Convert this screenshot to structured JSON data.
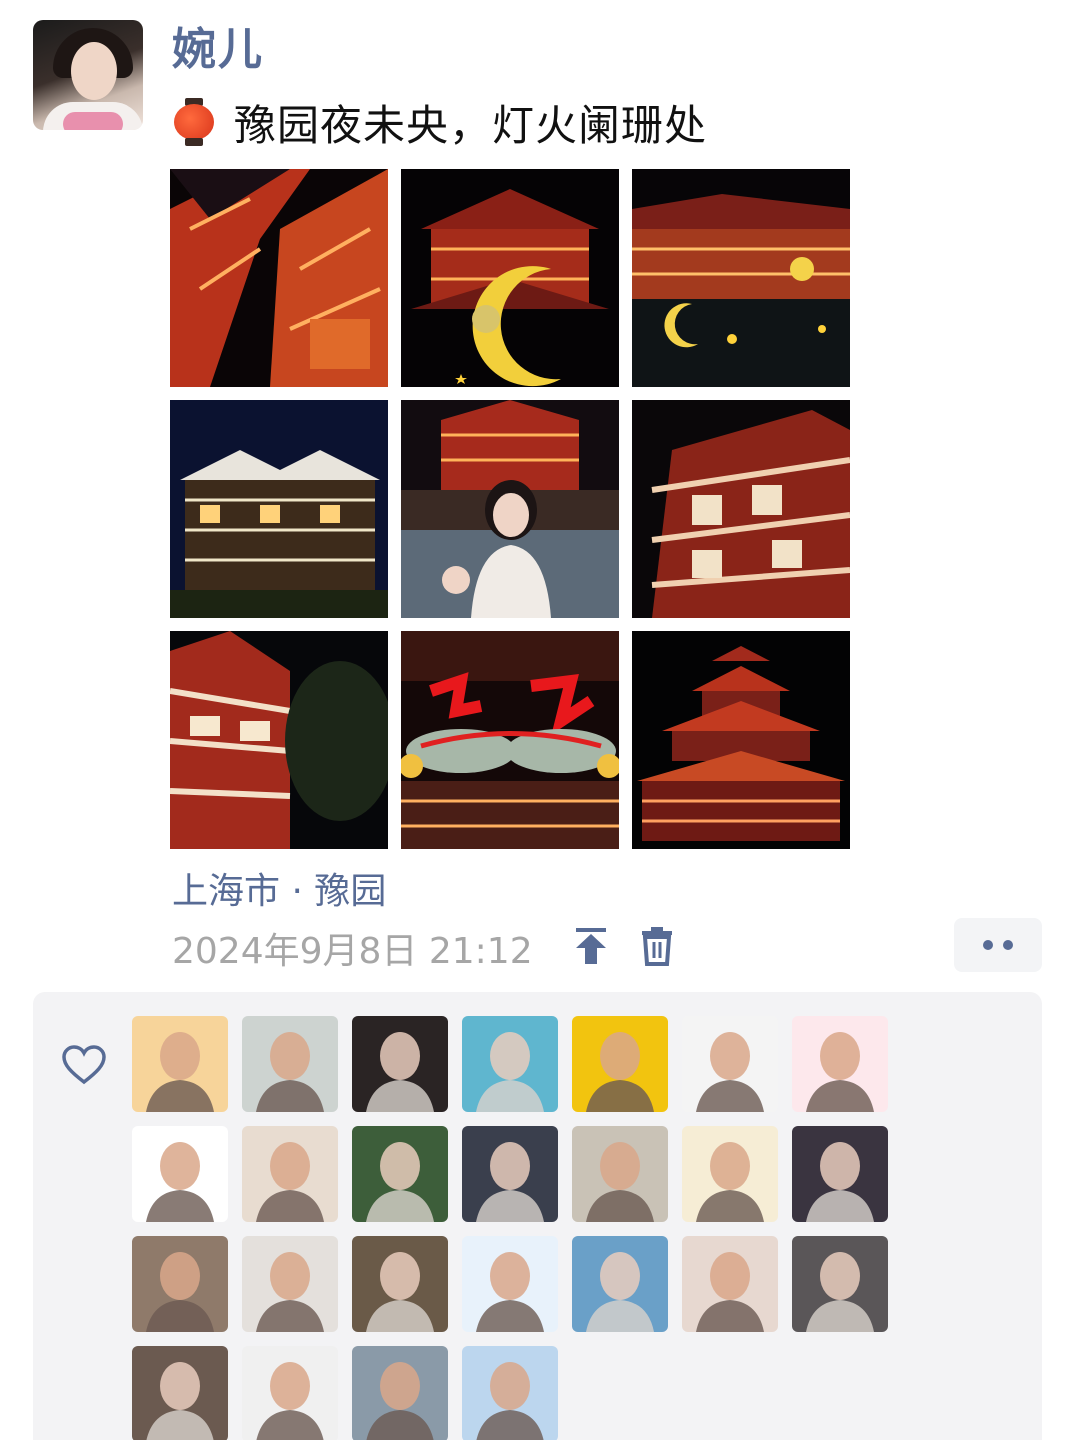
{
  "post": {
    "author": "婉儿",
    "caption": "豫园夜未央，灯火阑珊处",
    "caption_emoji": "lantern-icon",
    "location": "上海市 · 豫园",
    "timestamp": "2024年9月8日 21:12"
  },
  "photos": [
    {
      "name": "photo-1",
      "subject": "red-lit eaves close-up"
    },
    {
      "name": "photo-2",
      "subject": "pavilion with crescent moon lantern"
    },
    {
      "name": "photo-3",
      "subject": "pavilion over water with moon decorations"
    },
    {
      "name": "photo-4",
      "subject": "white-lit pavilion"
    },
    {
      "name": "photo-5",
      "subject": "selfie in street with pagoda"
    },
    {
      "name": "photo-6",
      "subject": "red-lit building corner"
    },
    {
      "name": "photo-7",
      "subject": "lit tower with tree"
    },
    {
      "name": "photo-8",
      "subject": "red neon sign with hand gesture"
    },
    {
      "name": "photo-9",
      "subject": "multi-level lit pagoda"
    }
  ],
  "actions": {
    "pin_icon": "pin-to-top-icon",
    "delete_icon": "trash-icon",
    "more_icon": "more-icon"
  },
  "likes": {
    "icon": "heart-icon",
    "avatars": [
      {
        "bg": "#f7d49a"
      },
      {
        "bg": "#cdd3d0"
      },
      {
        "bg": "#2a2424"
      },
      {
        "bg": "#5fb6cf"
      },
      {
        "bg": "#f2c40f"
      },
      {
        "bg": "#f4f4f4"
      },
      {
        "bg": "#fde8ec"
      },
      {
        "bg": "#ffffff"
      },
      {
        "bg": "#e8dcd0"
      },
      {
        "bg": "#3d5e3a"
      },
      {
        "bg": "#3a3f4d"
      },
      {
        "bg": "#c9c2b6"
      },
      {
        "bg": "#f6edd5"
      },
      {
        "bg": "#3a3440"
      },
      {
        "bg": "#8f7a6a"
      },
      {
        "bg": "#e4e0dc"
      },
      {
        "bg": "#6a5a48"
      },
      {
        "bg": "#e8f2fb"
      },
      {
        "bg": "#6aa0c8"
      },
      {
        "bg": "#e7d8d0"
      },
      {
        "bg": "#5a5658"
      },
      {
        "bg": "#6b5a50"
      },
      {
        "bg": "#f0f0f0"
      },
      {
        "bg": "#8a9aa8"
      },
      {
        "bg": "#bcd6ee"
      }
    ]
  }
}
